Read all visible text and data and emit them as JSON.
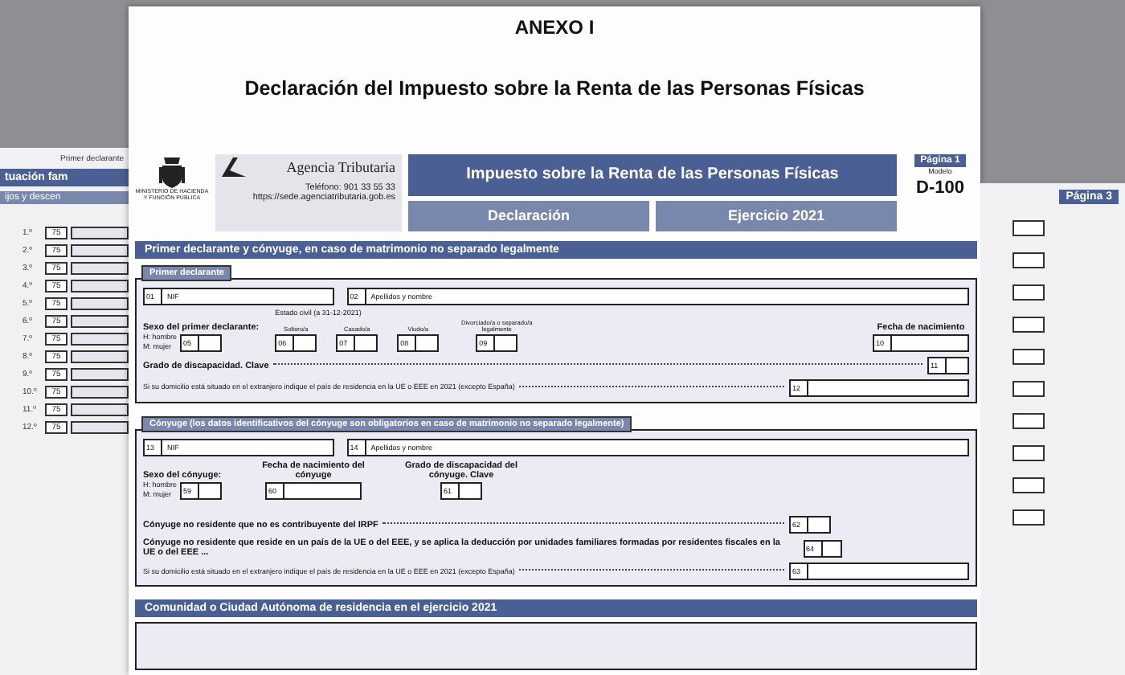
{
  "left_page": {
    "header_label": "Primer declarante",
    "section_title": "tuación fam",
    "subsection_title": "ijos y descen",
    "rows": [
      {
        "ordinal": "1.º",
        "code": "75"
      },
      {
        "ordinal": "2.º",
        "code": "75"
      },
      {
        "ordinal": "3.º",
        "code": "75"
      },
      {
        "ordinal": "4.º",
        "code": "75"
      },
      {
        "ordinal": "5.º",
        "code": "75"
      },
      {
        "ordinal": "6.º",
        "code": "75"
      },
      {
        "ordinal": "7.º",
        "code": "75"
      },
      {
        "ordinal": "8.º",
        "code": "75"
      },
      {
        "ordinal": "9.º",
        "code": "75"
      },
      {
        "ordinal": "10.º",
        "code": "75"
      },
      {
        "ordinal": "11.º",
        "code": "75"
      },
      {
        "ordinal": "12.º",
        "code": "75"
      }
    ]
  },
  "main_page": {
    "annex": "ANEXO I",
    "title": "Declaración del Impuesto sobre la Renta de las Personas Físicas",
    "header": {
      "ministry": "MINISTERIO DE HACIENDA Y FUNCIÓN PÚBLICA",
      "agency": "Agencia Tributaria",
      "phone": "Teléfono: 901 33 55 33",
      "url": "https://sede.agenciatributaria.gob.es",
      "form_title": "Impuesto sobre la Renta de las Personas Físicas",
      "form_type": "Declaración",
      "year_label": "Ejercicio 2021",
      "page_label": "Página 1",
      "model_label": "Modelo",
      "model_code": "D-100"
    },
    "section_title": "Primer declarante y cónyuge, en caso de matrimonio no separado legalmente",
    "first_declarant": {
      "tab": "Primer declarante",
      "nif": {
        "code": "01",
        "label": "NIF"
      },
      "name": {
        "code": "02",
        "label": "Apellidos y nombre"
      },
      "sex": {
        "label": "Sexo del primer declarante:",
        "options": [
          "H: hombre",
          "M: mujer"
        ],
        "code": "05"
      },
      "civil_status": {
        "label": "Estado civil (a 31-12-2021)",
        "options": [
          {
            "label": "Soltero/a",
            "code": "06"
          },
          {
            "label": "Casado/a",
            "code": "07"
          },
          {
            "label": "Viudo/a",
            "code": "08"
          },
          {
            "label": "Divorciado/a o separado/a legalmente",
            "code": "09"
          }
        ]
      },
      "birth": {
        "label": "Fecha de nacimiento",
        "code": "10"
      },
      "disability": {
        "label": "Grado de discapacidad. Clave",
        "code": "11"
      },
      "residence": {
        "label": "Si su domicilio está situado en el extranjero indique el país de residencia en la UE o EEE en 2021 (excepto España)",
        "code": "12"
      }
    },
    "spouse": {
      "tab": "Cónyuge (los datos identificativos del cónyuge son obligatorios en caso de matrimonio no separado legalmente)",
      "nif": {
        "code": "13",
        "label": "NIF"
      },
      "name": {
        "code": "14",
        "label": "Apellidos y nombre"
      },
      "sex": {
        "label": "Sexo del cónyuge:",
        "options": [
          "H: hombre",
          "M: mujer"
        ],
        "code": "59"
      },
      "birth": {
        "label": "Fecha de nacimiento del cónyuge",
        "code": "60"
      },
      "disability": {
        "label": "Grado de discapacidad del cónyuge. Clave",
        "code": "61"
      },
      "lines": [
        {
          "kind": "short",
          "label": "Cónyuge no residente que no es contribuyente del IRPF",
          "code": "62"
        },
        {
          "kind": "short",
          "label": "Cónyuge no residente que reside en un país de la UE o del EEE, y se aplica la deducción por unidades familiares formadas por residentes fiscales en la UE o del EEE ...",
          "code": "64"
        },
        {
          "kind": "wide",
          "label": "Si su domicilio está situado en el extranjero indique el país de residencia en la UE o EEE en 2021 (excepto España)",
          "code": "63"
        }
      ]
    },
    "next_section_title": "Comunidad o Ciudad Autónoma de residencia en el ejercicio 2021"
  },
  "right_page": {
    "page_label": "Página 3"
  }
}
